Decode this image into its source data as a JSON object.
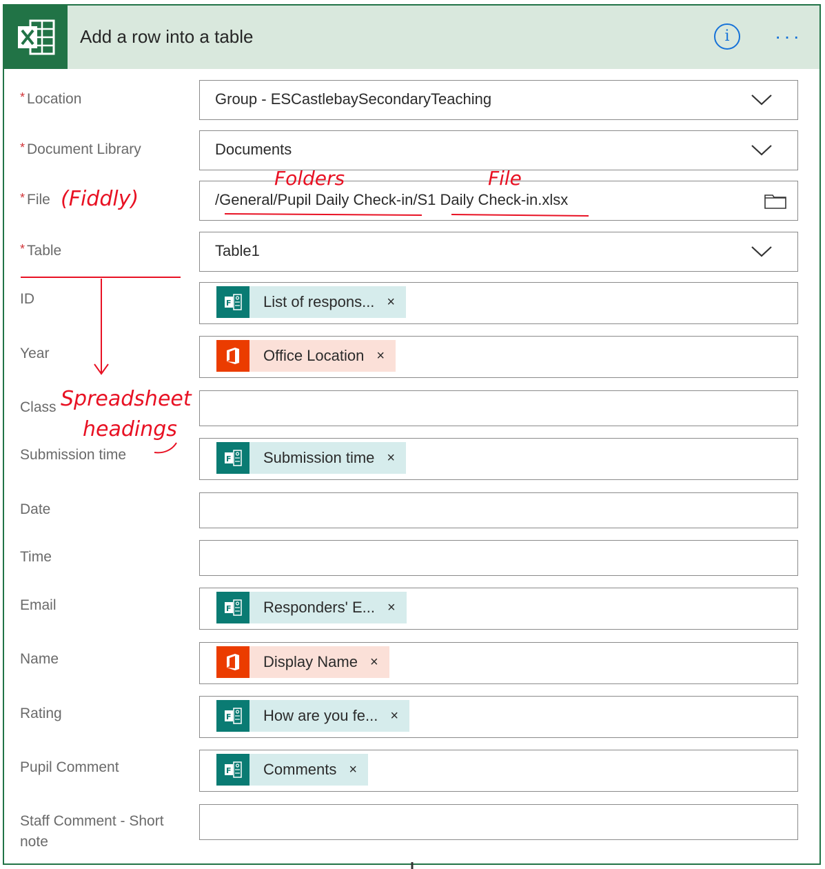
{
  "header": {
    "title": "Add a row into a table",
    "info_label": "i",
    "more_label": "···",
    "colors": {
      "brand": "#217346",
      "accent": "#1672d8"
    }
  },
  "fields": [
    {
      "label": "Location",
      "required": true,
      "value": "Group - ESCastlebaySecondaryTeaching",
      "control": "dropdown"
    },
    {
      "label": "Document Library",
      "required": true,
      "value": "Documents",
      "control": "dropdown"
    },
    {
      "label": "File",
      "required": true,
      "value": "/General/Pupil Daily Check-in/S1 Daily Check-in.xlsx",
      "control": "file-picker"
    },
    {
      "label": "Table",
      "required": true,
      "value": "Table1",
      "control": "dropdown"
    },
    {
      "label": "ID",
      "token": "List of respons...",
      "token_source": "forms"
    },
    {
      "label": "Year",
      "token": "Office Location",
      "token_source": "office"
    },
    {
      "label": "Class",
      "value": ""
    },
    {
      "label": "Submission time",
      "token": "Submission time",
      "token_source": "forms"
    },
    {
      "label": "Date",
      "value": ""
    },
    {
      "label": "Time",
      "value": ""
    },
    {
      "label": "Email",
      "token": "Responders' E...",
      "token_source": "forms"
    },
    {
      "label": "Name",
      "token": "Display Name",
      "token_source": "office"
    },
    {
      "label": "Rating",
      "token": "How are you fe...",
      "token_source": "forms"
    },
    {
      "label": "Pupil Comment",
      "token": "Comments",
      "token_source": "forms"
    },
    {
      "label": "Staff Comment - Short note",
      "value": ""
    }
  ],
  "token_remove_label": "×",
  "required_mark": "*",
  "annotations": {
    "fiddly": "(Fiddly)",
    "folders": "Folders",
    "file": "File",
    "spreadsheet": "Spreadsheet",
    "headings": "headings",
    "color": "#e81123"
  }
}
